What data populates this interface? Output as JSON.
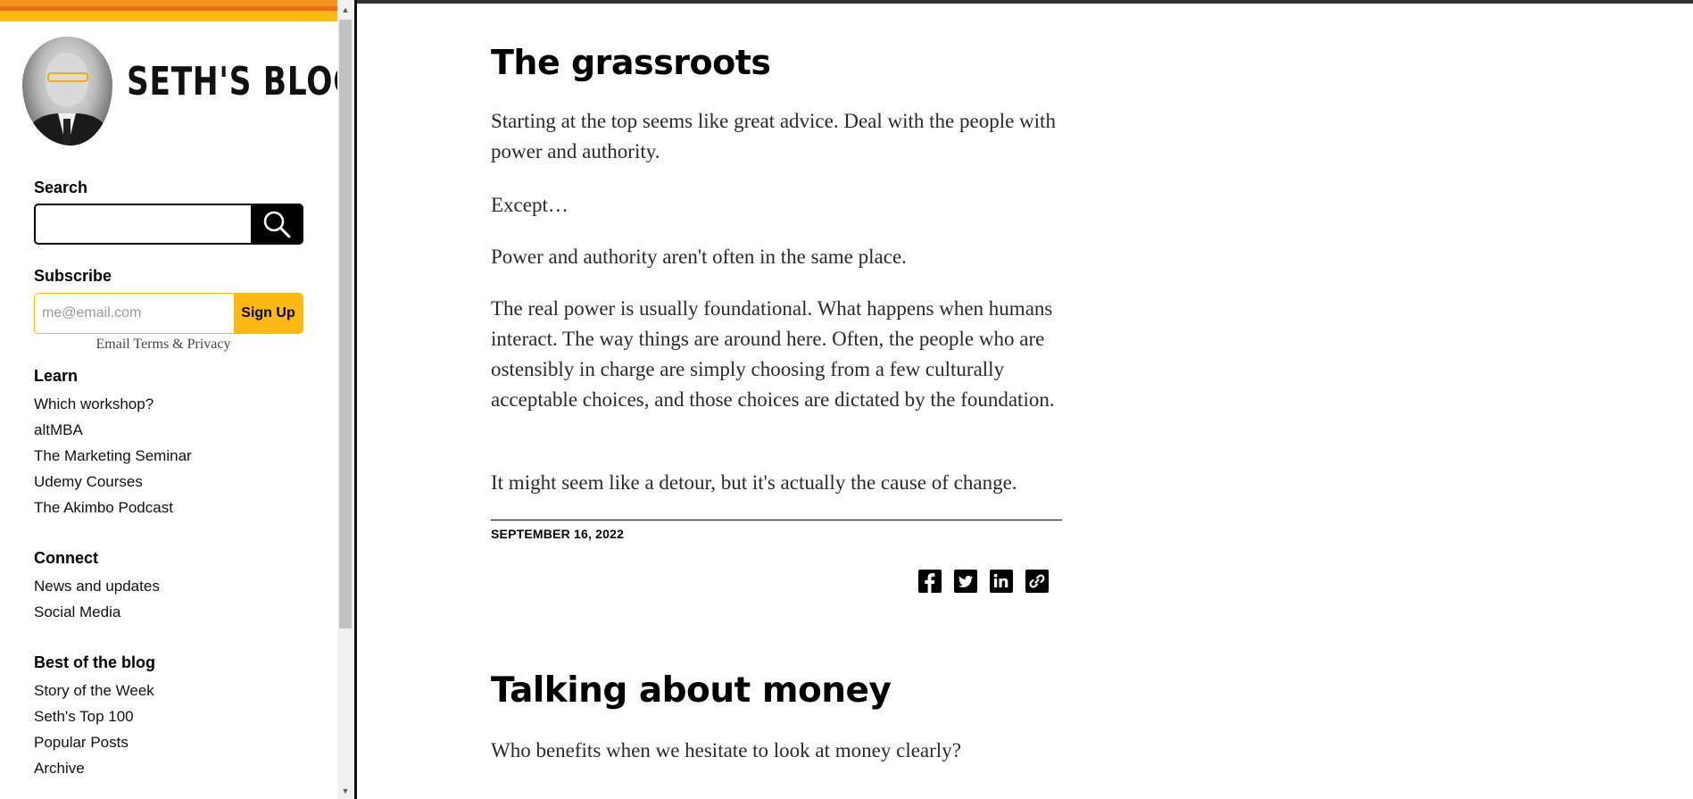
{
  "sidebar": {
    "site_title": "SETH'S BLOG",
    "search": {
      "label": "Search",
      "value": "",
      "button_icon": "search-icon"
    },
    "subscribe": {
      "label": "Subscribe",
      "email_placeholder": "me@email.com",
      "button_label": "Sign Up",
      "terms_text": "Email Terms & Privacy"
    },
    "sections": [
      {
        "heading": "Learn",
        "items": [
          "Which workshop?",
          "altMBA",
          "The Marketing Seminar",
          "Udemy Courses",
          "The Akimbo Podcast"
        ]
      },
      {
        "heading": "Connect",
        "items": [
          "News and updates",
          "Social Media"
        ]
      },
      {
        "heading": "Best of the blog",
        "items": [
          "Story of the Week",
          "Seth's Top 100",
          "Popular Posts",
          "Archive"
        ]
      }
    ]
  },
  "posts": [
    {
      "title": "The grassroots",
      "paragraphs": [
        "Starting at the top seems like great advice. Deal with the people with power and authority.",
        "Except…",
        "Power and authority aren't often in the same place.",
        "The real power is usually foundational. What happens when humans interact. The way things are around here. Often, the people who are ostensibly in charge are simply choosing from a few culturally acceptable choices, and those choices are dictated by the foundation.",
        "It might seem like a detour, but it's actually the cause of change."
      ],
      "date": "SEPTEMBER 16, 2022",
      "share_icons": [
        "facebook-icon",
        "twitter-icon",
        "linkedin-icon",
        "link-icon"
      ]
    },
    {
      "title": "Talking about money",
      "paragraphs": [
        "Who benefits when we hesitate to look at money clearly?"
      ]
    }
  ],
  "colors": {
    "accent_orange": "#f7941d",
    "accent_deep_orange": "#f26722",
    "accent_yellow": "#fdb913",
    "text": "#2a2a2a"
  }
}
